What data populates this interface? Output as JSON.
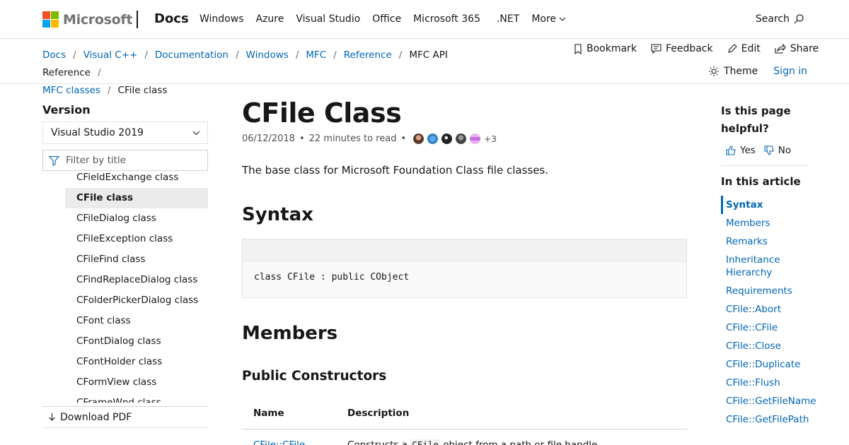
{
  "header": {
    "brand": "Microsoft",
    "site": "Docs",
    "nav": [
      "Windows",
      "Azure",
      "Visual Studio",
      "Office",
      "Microsoft 365",
      ".NET"
    ],
    "more_label": "More",
    "search_label": "Search"
  },
  "breadcrumb": {
    "items": [
      "Docs",
      "Visual C++",
      "Documentation",
      "Windows",
      "MFC",
      "Reference",
      "MFC API Reference",
      "MFC classes",
      "CFile class"
    ]
  },
  "actions": {
    "bookmark": "Bookmark",
    "feedback": "Feedback",
    "edit": "Edit",
    "share": "Share",
    "theme": "Theme",
    "sign_in": "Sign in"
  },
  "sidebar": {
    "version_label": "Version",
    "version_value": "Visual Studio 2019",
    "filter_placeholder": "Filter by title",
    "toc": [
      "CFieldExchange class",
      "CFile class",
      "CFileDialog class",
      "CFileException class",
      "CFileFind class",
      "CFindReplaceDialog class",
      "CFolderPickerDialog class",
      "CFont class",
      "CFontDialog class",
      "CFontHolder class",
      "CFormView class",
      "CFrameWnd class"
    ],
    "active_index": 1,
    "download_pdf": "Download PDF"
  },
  "article": {
    "title": "CFile Class",
    "date": "06/12/2018",
    "read_time": "22 minutes to read",
    "contributors_more": "+3",
    "lead": "The base class for Microsoft Foundation Class file classes.",
    "syntax_heading": "Syntax",
    "code": "class CFile : public CObject",
    "members_heading": "Members",
    "constructors_heading": "Public Constructors",
    "table_headers": [
      "Name",
      "Description"
    ],
    "rows": [
      {
        "name": "CFile::CFile",
        "desc_before": "Constructs a ",
        "desc_code": "CFile",
        "desc_after": " object from a path or file handle."
      }
    ]
  },
  "rail": {
    "helpful_question": "Is this page helpful?",
    "yes": "Yes",
    "no": "No",
    "in_this_article": "In this article",
    "outline": [
      "Syntax",
      "Members",
      "Remarks",
      "Inheritance Hierarchy",
      "Requirements",
      "CFile::Abort",
      "CFile::CFile",
      "CFile::Close",
      "CFile::Duplicate",
      "CFile::Flush",
      "CFile::GetFileName",
      "CFile::GetFilePath"
    ],
    "current_index": 0
  },
  "colors": {
    "link": "#0065b3",
    "text": "#171717",
    "border": "#e3e3e3"
  }
}
